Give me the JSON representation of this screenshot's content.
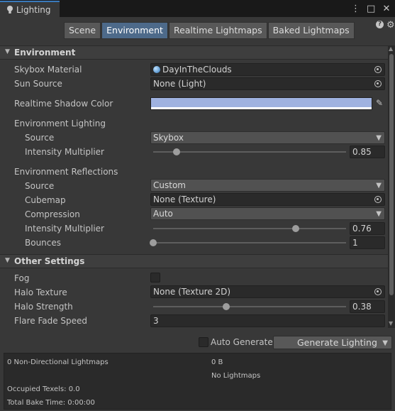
{
  "window": {
    "tab_title": "Lighting",
    "icons": [
      "lightbulb-icon",
      "more-vert-icon",
      "maximize-icon",
      "close-icon"
    ]
  },
  "toolbar": {
    "tabs": [
      "Scene",
      "Environment",
      "Realtime Lightmaps",
      "Baked Lightmaps"
    ],
    "active_tab": "Environment"
  },
  "environment": {
    "header": "Environment",
    "skybox_material": {
      "label": "Skybox Material",
      "value": "DayInTheClouds"
    },
    "sun_source": {
      "label": "Sun Source",
      "value": "None (Light)"
    },
    "realtime_shadow_color": {
      "label": "Realtime Shadow Color",
      "color": "#9fb2e0"
    },
    "lighting": {
      "label": "Environment Lighting",
      "source": {
        "label": "Source",
        "value": "Skybox"
      },
      "intensity": {
        "label": "Intensity Multiplier",
        "value": "0.85",
        "fraction": 0.12
      }
    },
    "reflections": {
      "label": "Environment Reflections",
      "source": {
        "label": "Source",
        "value": "Custom"
      },
      "cubemap": {
        "label": "Cubemap",
        "value": "None (Texture)"
      },
      "compression": {
        "label": "Compression",
        "value": "Auto"
      },
      "intensity": {
        "label": "Intensity Multiplier",
        "value": "0.76",
        "fraction": 0.74
      },
      "bounces": {
        "label": "Bounces",
        "value": "1",
        "fraction": 0.0
      }
    }
  },
  "other": {
    "header": "Other Settings",
    "fog": {
      "label": "Fog",
      "checked": false
    },
    "halo_texture": {
      "label": "Halo Texture",
      "value": "None (Texture 2D)"
    },
    "halo_strength": {
      "label": "Halo Strength",
      "value": "0.38",
      "fraction": 0.38
    },
    "flare_fade_speed": {
      "label": "Flare Fade Speed",
      "value": "3"
    }
  },
  "generate": {
    "auto_label": "Auto Generate",
    "auto_checked": false,
    "button_label": "Generate Lighting"
  },
  "stats": {
    "lightmaps": "0 Non-Directional Lightmaps",
    "size": "0 B",
    "no_lightmaps": "No Lightmaps",
    "occupied_texels": "Occupied Texels: 0.0",
    "total_bake_time": "Total Bake Time: 0:00:00"
  },
  "colors": {
    "accent": "#3a79bb",
    "active_tab": "#4d6a8a",
    "background": "#383838"
  }
}
